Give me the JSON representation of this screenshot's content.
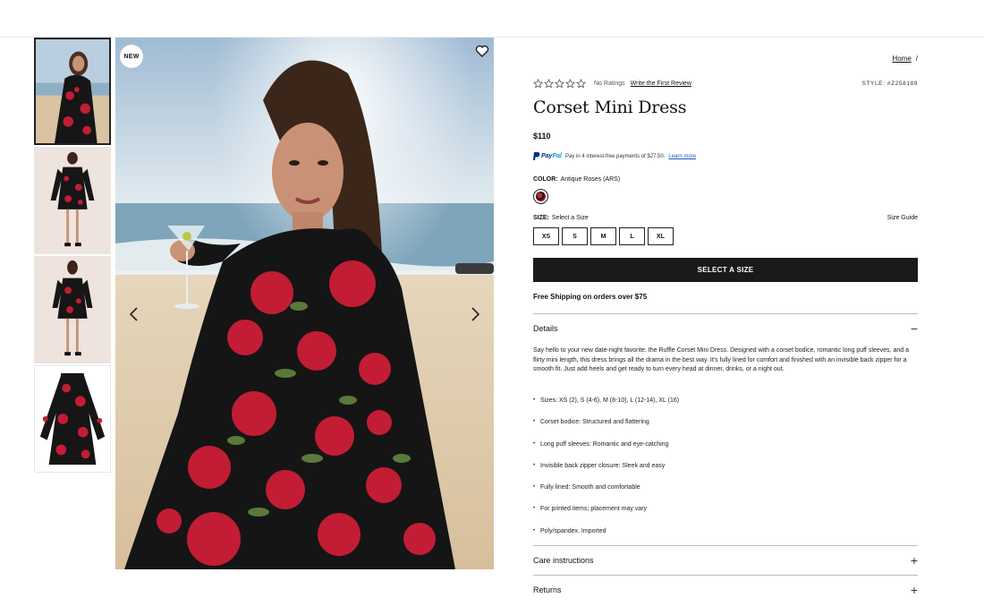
{
  "gallery": {
    "badge": "NEW",
    "thumbnails": [
      "thumb-beach",
      "thumb-front",
      "thumb-back",
      "thumb-flat"
    ]
  },
  "breadcrumb": {
    "home": "Home",
    "sep": "/"
  },
  "rating": {
    "no_ratings": "No Ratings",
    "write_review": "Write the First Review",
    "style": "STYLE: #Z258189"
  },
  "product": {
    "title": "Corset Mini Dress",
    "price": "$110",
    "paypal": {
      "brand1": "Pay",
      "brand2": "Pal",
      "text": "Pay in 4 interest-free payments of $27.50.",
      "learn_more": "Learn more"
    },
    "color_label": "COLOR:",
    "color_value": "Antique Roses (ARS)",
    "size_label": "SIZE:",
    "size_value": "Select a Size",
    "size_guide": "Size Guide",
    "sizes": [
      "XS",
      "S",
      "M",
      "L",
      "XL"
    ],
    "select_button": "SELECT A SIZE",
    "shipping": "Free Shipping on orders over $75"
  },
  "details": {
    "title": "Details",
    "sign": "−",
    "description": "Say hello to your new date-night favorite: the Ruffle Corset Mini Dress. Designed with a corset bodice, romantic long puff sleeves, and a flirty mini length, this dress brings all the drama in the best way. It's fully lined for comfort and finished with an invisible back zipper for a smooth fit. Just add heels and get ready to turn every head at dinner, drinks, or a night out.",
    "bullets": [
      "Sizes: XS (2), S (4-6), M (8-10), L (12-14), XL (16)",
      "Corset bodice: Structured and flattering",
      "Long puff sleeves: Romantic and eye-catching",
      "Invisible back zipper closure: Sleek and easy",
      "Fully lined: Smooth and comfortable",
      "For printed items; placement may vary",
      "Poly/spandex. Imported"
    ]
  },
  "care": {
    "title": "Care instructions",
    "sign": "+"
  },
  "returns": {
    "title": "Returns",
    "sign": "+"
  }
}
